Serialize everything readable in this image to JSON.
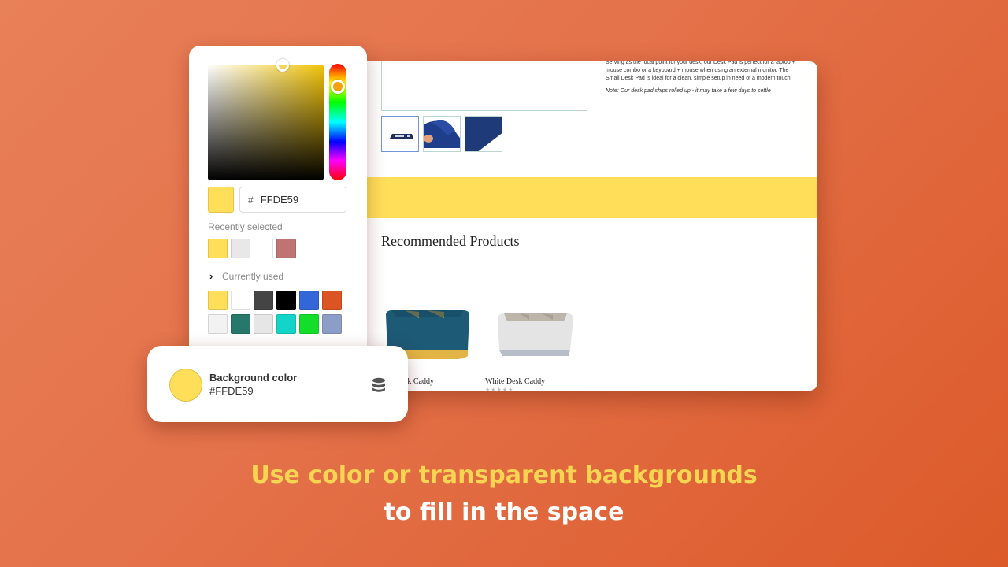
{
  "store_preview": {
    "description": "Serving as the focal point for your desk, our Desk Pad is perfect for a laptop + mouse combo or a keyboard + mouse when using an external monitor. The Small Desk Pad is ideal for a clean, simple setup in need of a modern touch.",
    "note": "Note: Our desk pad ships rolled up - it may take a few days to settle",
    "thumbnails": [
      "desk-pad-top-view",
      "desk-pad-hand-lifting",
      "desk-pad-corner-closeup"
    ],
    "band_color": "#FFDE59",
    "section_title": "Recommended Products",
    "products": [
      {
        "name": "Blue Desk Caddy",
        "visible_name": "esk Caddy",
        "stars": "★★★★★"
      },
      {
        "name": "White Desk Caddy",
        "visible_name": "White Desk Caddy",
        "stars": "★★★★★"
      }
    ]
  },
  "color_picker": {
    "hex_prefix": "#",
    "hex_value": "FFDE59",
    "selected_color": "#FFDE59",
    "recently_selected_label": "Recently selected",
    "recently_selected": [
      "#FFDE59",
      "#E8E8E8",
      "#FFFFFF",
      "#C07373"
    ],
    "currently_used_label": "Currently used",
    "chevron": "›",
    "currently_used": [
      [
        "#FFDE59",
        "#FFFFFF",
        "#444444",
        "#000000",
        "#3366D6",
        "#DD5424"
      ],
      [
        "#F2F2F2",
        "#27786A",
        "#E6E6E6",
        "#12D4C8",
        "#13DE2A",
        "#8C9DC8"
      ]
    ]
  },
  "background_card": {
    "title": "Background color",
    "hex": "#FFDE59",
    "color": "#FFDE59",
    "icon": "database-icon"
  },
  "caption": {
    "line1": "Use color or transparent backgrounds",
    "line2": "to fill in the space"
  }
}
